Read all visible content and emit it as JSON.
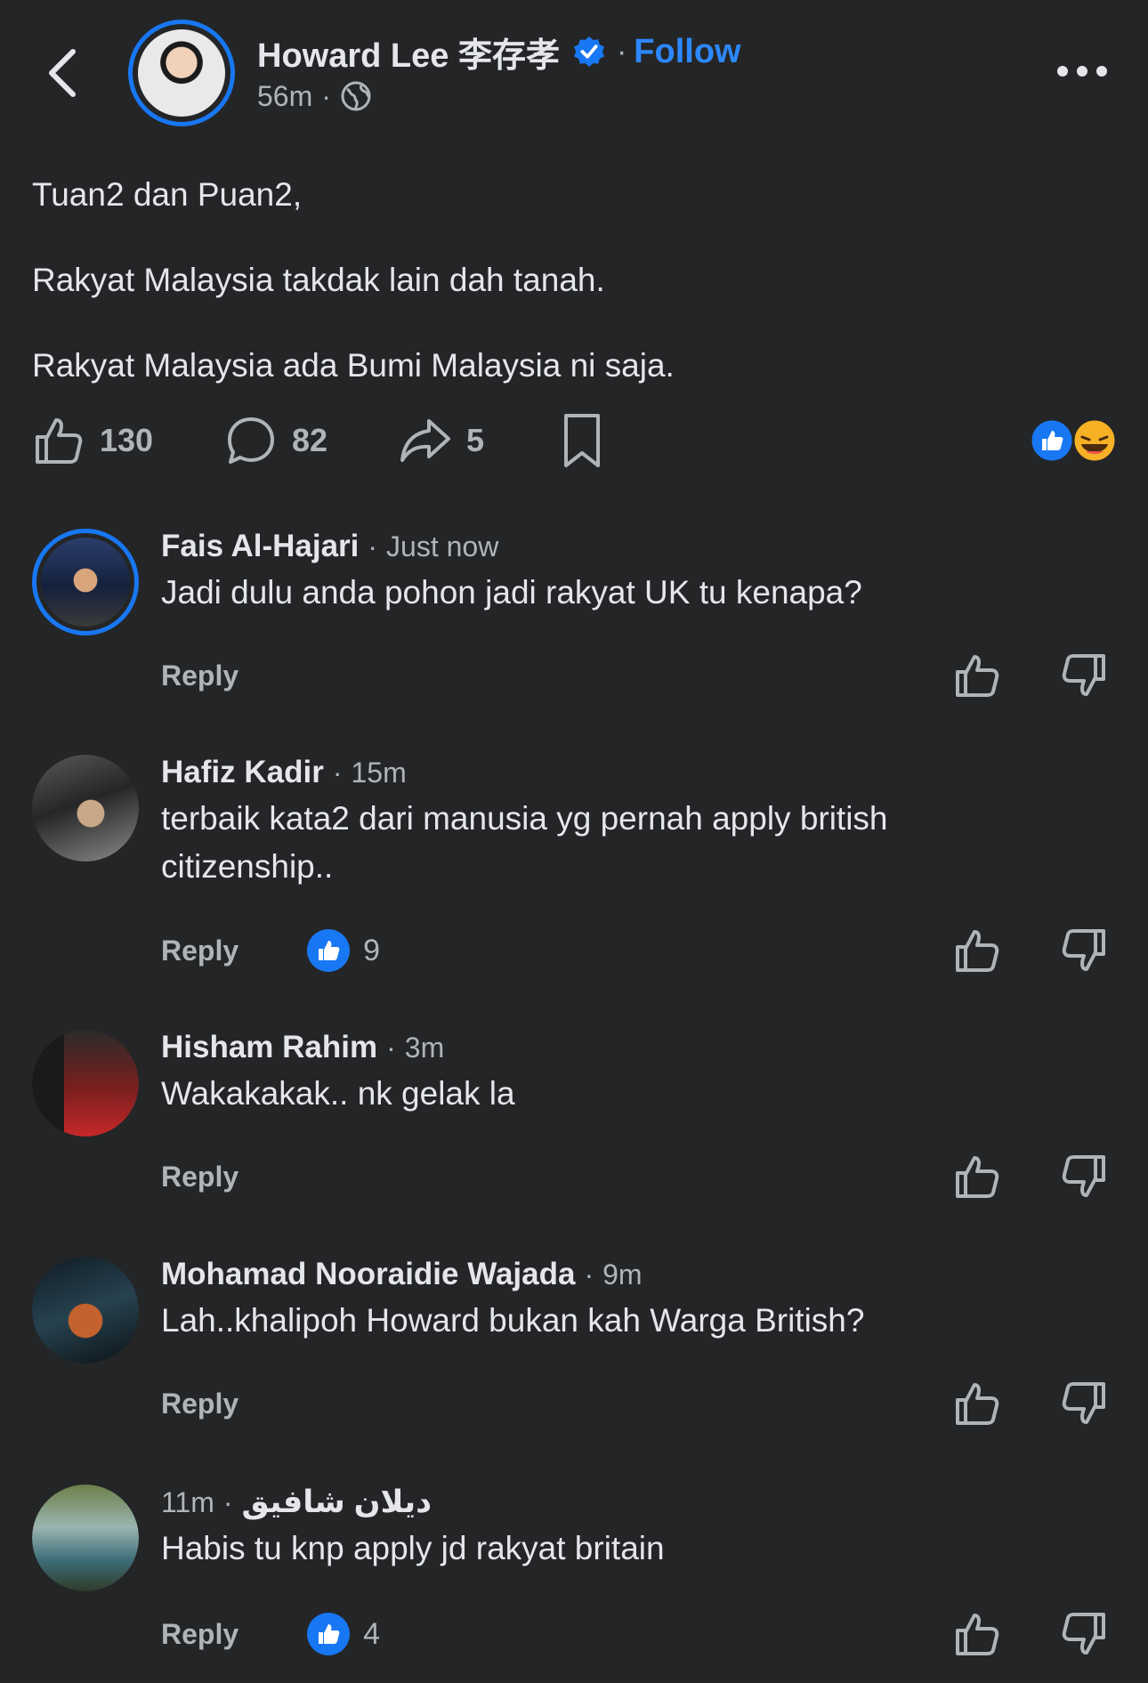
{
  "header": {
    "author_name": "Howard Lee 李存孝",
    "separator": "·",
    "follow_label": "Follow",
    "time": "56m",
    "time_separator": "·",
    "audience_icon": "globe-icon"
  },
  "post": {
    "paragraphs": [
      "Tuan2 dan Puan2,",
      "Rakyat Malaysia takdak lain dah tanah.",
      "Rakyat Malaysia ada Bumi Malaysia ni saja."
    ]
  },
  "actions": {
    "like_count": "130",
    "comment_count": "82",
    "share_count": "5"
  },
  "comments": [
    {
      "name": "Fais Al-Hajari",
      "separator": "·",
      "time": "Just now",
      "text": "Jadi dulu anda pohon jadi rakyat UK tu kenapa?",
      "reply_label": "Reply"
    },
    {
      "name": "Hafiz Kadir",
      "separator": "·",
      "time": "15m",
      "text_line1": "terbaik kata2 dari manusia yg pernah apply british",
      "text_line2": "citizenship..",
      "reply_label": "Reply",
      "like_count": "9"
    },
    {
      "name": "Hisham Rahim",
      "separator": "·",
      "time": "3m",
      "text": "Wakakakak.. nk gelak la",
      "reply_label": "Reply"
    },
    {
      "name": "Mohamad Nooraidie Wajada",
      "separator": "·",
      "time": "9m",
      "text": "Lah..khalipoh Howard bukan kah Warga British?",
      "reply_label": "Reply"
    },
    {
      "name": "ديلان شافيق",
      "separator": "·",
      "time": "11m",
      "text": "Habis tu knp apply jd rakyat britain",
      "reply_label": "Reply",
      "like_count": "4"
    }
  ],
  "colors": {
    "background": "#242526",
    "accent": "#2d88ff",
    "text": "#e4e6eb",
    "muted": "#b0b3b8"
  }
}
